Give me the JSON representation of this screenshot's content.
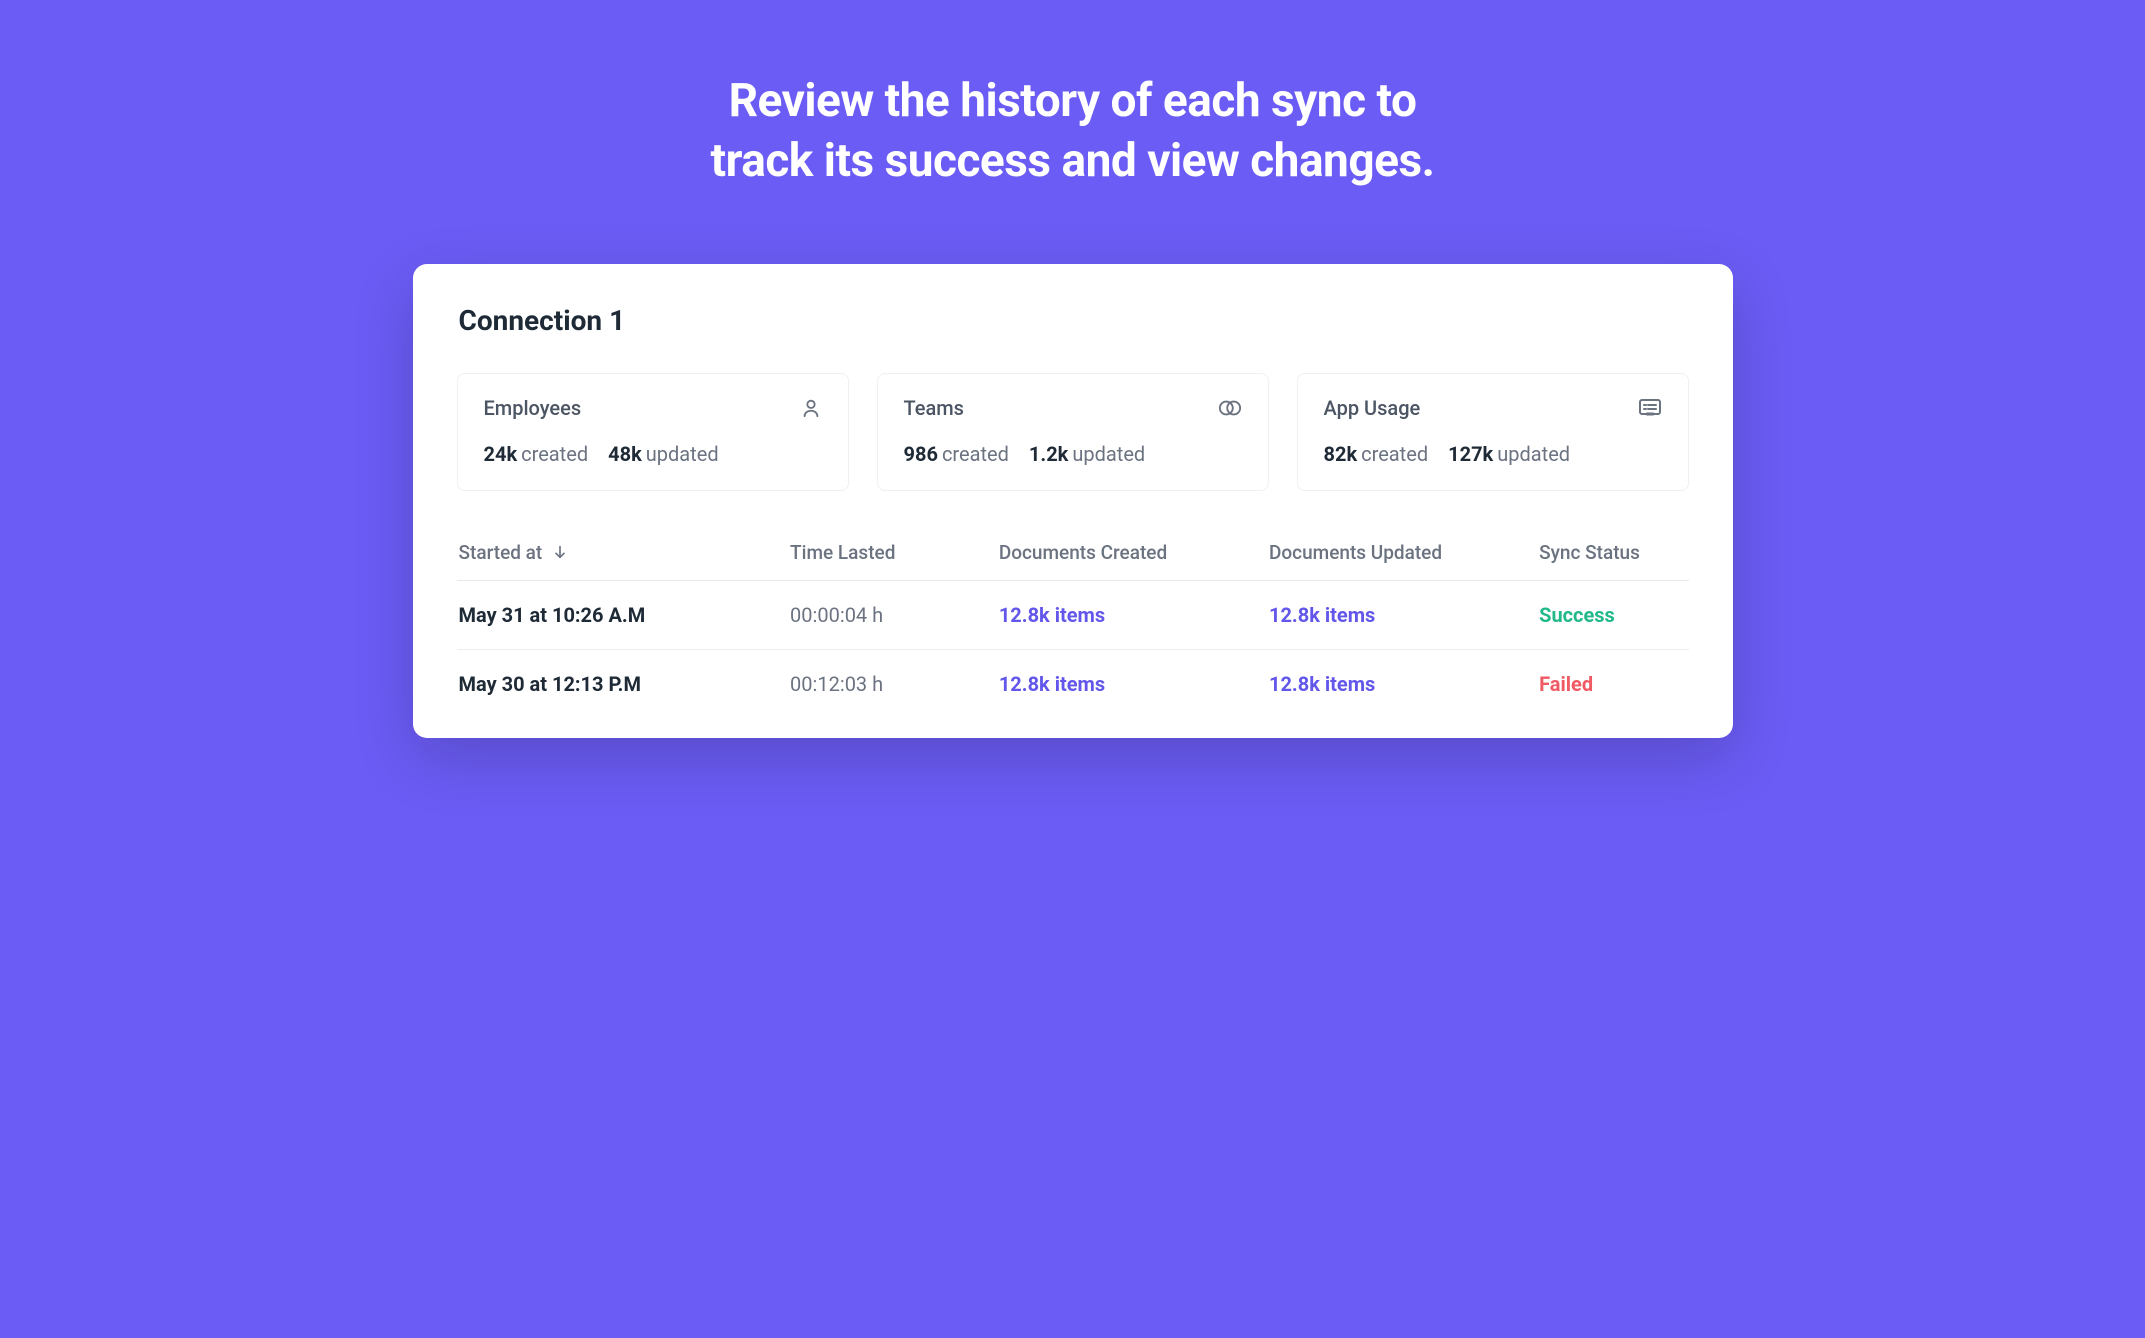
{
  "headline_line1": "Review the history of each sync to",
  "headline_line2": "track its success and view changes.",
  "card": {
    "title": "Connection 1",
    "stats": [
      {
        "label": "Employees",
        "created_value": "24k",
        "created_suffix": "created",
        "updated_value": "48k",
        "updated_suffix": "updated"
      },
      {
        "label": "Teams",
        "created_value": "986",
        "created_suffix": "created",
        "updated_value": "1.2k",
        "updated_suffix": "updated"
      },
      {
        "label": "App Usage",
        "created_value": "82k",
        "created_suffix": "created",
        "updated_value": "127k",
        "updated_suffix": "updated"
      }
    ],
    "columns": {
      "started_at": "Started at",
      "time_lasted": "Time Lasted",
      "docs_created": "Documents Created",
      "docs_updated": "Documents Updated",
      "sync_status": "Sync Status"
    },
    "rows": [
      {
        "started_at": "May 31 at 10:26 A.M",
        "time_lasted": "00:00:04 h",
        "docs_created": "12.8k items",
        "docs_updated": "12.8k items",
        "sync_status": "Success",
        "status_class": "success"
      },
      {
        "started_at": "May 30 at 12:13 P.M",
        "time_lasted": "00:12:03 h",
        "docs_created": "12.8k items",
        "docs_updated": "12.8k items",
        "sync_status": "Failed",
        "status_class": "failed"
      }
    ]
  }
}
